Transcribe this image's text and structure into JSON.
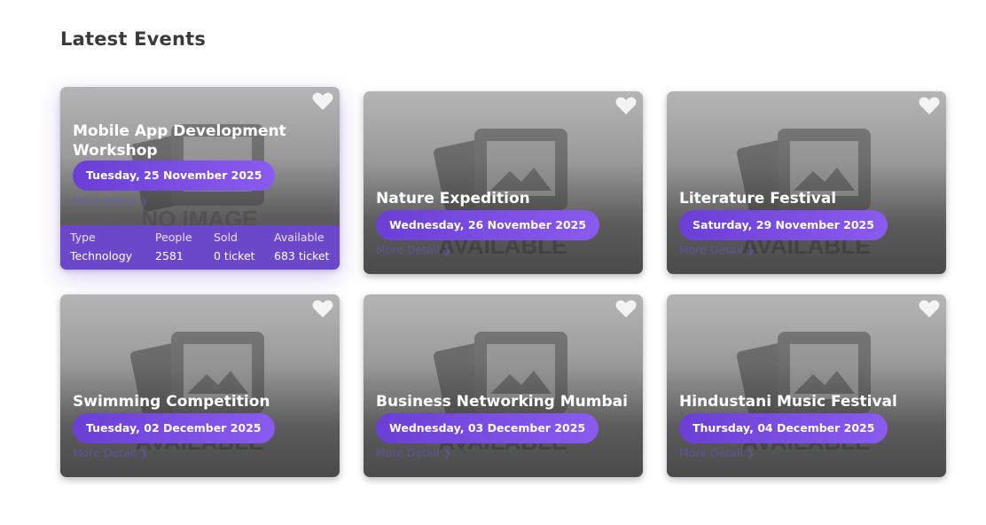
{
  "section": {
    "title": "Latest Events"
  },
  "placeholder": {
    "line1": "NO IMAGE",
    "line2": "AVAILABLE"
  },
  "more_label": "More Detail",
  "stats_labels": {
    "type": "Type",
    "people": "People",
    "sold": "Sold",
    "available": "Available"
  },
  "events": [
    {
      "title": "Mobile App Development Workshop",
      "date": "Tuesday, 25 November 2025",
      "type": "Technology",
      "people": "2581",
      "sold": "0 ticket",
      "available": "683 ticket"
    },
    {
      "title": "Nature Expedition",
      "date": "Wednesday, 26 November 2025"
    },
    {
      "title": "Literature Festival",
      "date": "Saturday, 29 November 2025"
    },
    {
      "title": "Swimming Competition",
      "date": "Tuesday, 02 December 2025"
    },
    {
      "title": "Business Networking Mumbai",
      "date": "Wednesday, 03 December 2025"
    },
    {
      "title": "Hindustani Music Festival",
      "date": "Thursday, 04 December 2025"
    }
  ],
  "colors": {
    "accent": "#6a3fd6",
    "accent_light": "#8a5bf0",
    "stats_bg": "#6b48c9",
    "heading": "#3b3b3b"
  },
  "icons": {
    "favorite": "heart-icon",
    "more": "chevron-right-icon",
    "placeholder": "image-placeholder-icon"
  }
}
